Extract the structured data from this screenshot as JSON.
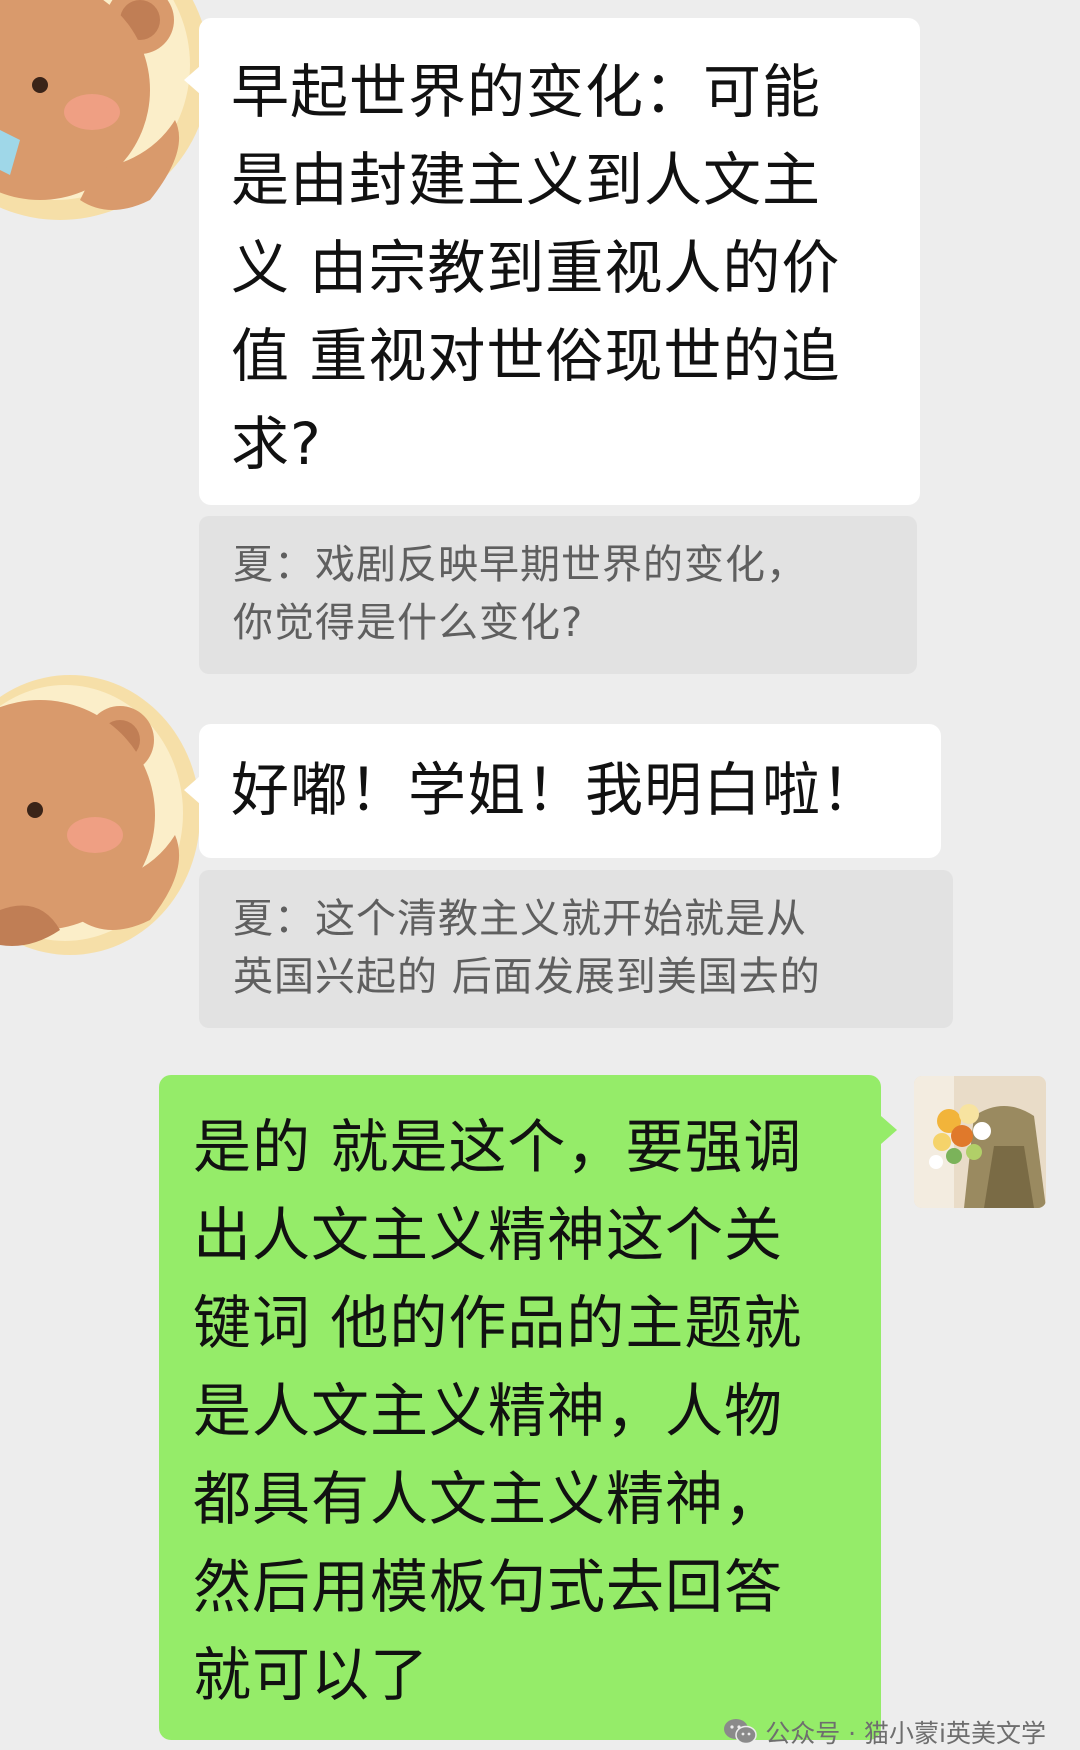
{
  "messages": [
    {
      "sender": "other",
      "text": "早起世界的变化：可能\n是由封建主义到人文主\n义 由宗教到重视人的价\n值 重视对世俗现世的追\n求?"
    },
    {
      "sender": "other_quote",
      "text": "夏：戏剧反映早期世界的变化，\n你觉得是什么变化?"
    },
    {
      "sender": "other",
      "text": "好嘟！学姐！我明白啦！"
    },
    {
      "sender": "other_quote",
      "text": "夏：这个清教主义就开始就是从\n英国兴起的 后面发展到美国去的"
    },
    {
      "sender": "self",
      "text": "是的 就是这个，要强调\n出人文主义精神这个关\n键词 他的作品的主题就\n是人文主义精神，人物\n都具有人文主义精神，\n然后用模板句式去回答\n就可以了"
    }
  ],
  "watermark": "公众号 · 猫小蒙i英美文学",
  "avatars": {
    "other": "bear-sticker-avatar",
    "self": "flower-bouquet-avatar"
  },
  "colors": {
    "background": "#ededed",
    "self_bubble": "#95ec69",
    "other_bubble": "#ffffff",
    "quote_bubble": "#e2e2e2"
  }
}
